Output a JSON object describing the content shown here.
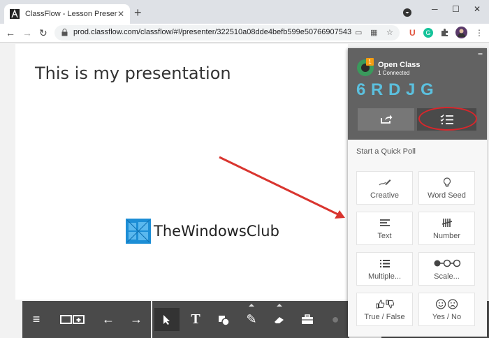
{
  "browser": {
    "tab_title": "ClassFlow - Lesson Presenter",
    "tab_close": "✕",
    "new_tab": "+",
    "url": "prod.classflow.com/classflow/#!/presenter/322510a08dde4befb599e50766907543",
    "window_controls": {
      "minimize": "─",
      "maximize": "☐",
      "close": "✕"
    },
    "extension_letter": "U"
  },
  "slide": {
    "title": "This is my presentation",
    "watermark": "TheWindowsClub"
  },
  "class_panel": {
    "badge": "1",
    "status": "Open Class",
    "connected": "1 Connected",
    "code": "6 R D J G",
    "quick_poll_label": "Start a Quick Poll",
    "poll_types": [
      {
        "label": "Creative",
        "icon": "creative-icon"
      },
      {
        "label": "Word Seed",
        "icon": "lightbulb-icon"
      },
      {
        "label": "Text",
        "icon": "text-icon"
      },
      {
        "label": "Number",
        "icon": "number-icon"
      },
      {
        "label": "Multiple...",
        "icon": "multiple-choice-icon"
      },
      {
        "label": "Scale...",
        "icon": "scale-icon"
      },
      {
        "label": "True / False",
        "icon": "thumbs-icon"
      },
      {
        "label": "Yes / No",
        "icon": "smiley-icon"
      }
    ]
  },
  "colors": {
    "accent_code": "#5bc0de",
    "highlight_ring": "#d9262b",
    "badge": "#f39c12"
  }
}
